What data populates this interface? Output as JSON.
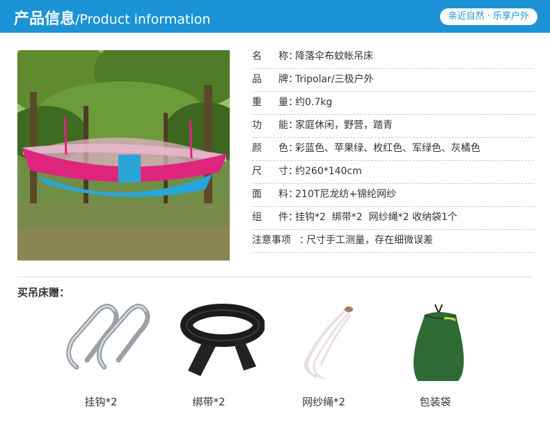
{
  "header": {
    "title_cn": "产品信息",
    "title_en": "/Product information",
    "badge": "亲近自然 · 乐享户外"
  },
  "specs": [
    {
      "label": "名称",
      "value": "降落伞布蚊帐吊床"
    },
    {
      "label": "品牌",
      "value": "Tripolar/三极户外"
    },
    {
      "label": "重量",
      "value": "约0.7kg"
    },
    {
      "label": "功能",
      "value": "家庭休闲，野营，踏青"
    },
    {
      "label": "颜色",
      "value": "彩蓝色、苹果绿、枚红色、军绿色、灰橘色"
    },
    {
      "label": "尺寸",
      "value": "约260*140cm"
    },
    {
      "label": "面料",
      "value": "210T尼龙纺+锦纶网纱"
    },
    {
      "label": "组件",
      "value": "挂钩*2  绑带*2  网纱绳*2 收纳袋1个"
    },
    {
      "label": "注意事项",
      "value": "尺寸手工测量，存在细微误差"
    }
  ],
  "gifts": {
    "title": "买吊床赠：",
    "items": [
      {
        "label": "挂钩*2",
        "icon": "carabiner-icon"
      },
      {
        "label": "绑带*2",
        "icon": "strap-icon"
      },
      {
        "label": "网纱绳*2",
        "icon": "rope-icon"
      },
      {
        "label": "包装袋",
        "icon": "bag-icon"
      }
    ]
  },
  "colors": {
    "header_bg": "#1b93d6",
    "hammock_pink": "#e0257f",
    "hammock_blue": "#2aa5d8"
  }
}
